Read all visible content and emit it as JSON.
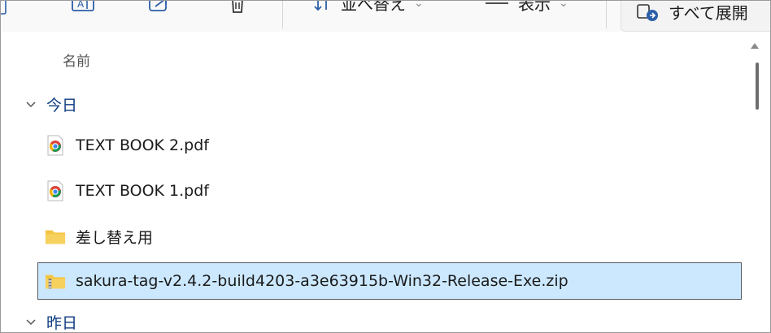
{
  "toolbar": {
    "sort_label": "並べ替え",
    "view_label": "表示",
    "expand_label": "すべて展開"
  },
  "columns": {
    "name_header": "名前"
  },
  "groups": [
    {
      "label": "今日"
    },
    {
      "label": "昨日"
    }
  ],
  "files": [
    {
      "name": "TEXT BOOK 2.pdf",
      "icon": "chrome-pdf-icon"
    },
    {
      "name": "TEXT BOOK 1.pdf",
      "icon": "chrome-pdf-icon"
    },
    {
      "name": "差し替え用",
      "icon": "folder-icon"
    },
    {
      "name": "sakura-tag-v2.4.2-build4203-a3e63915b-Win32-Release-Exe.zip",
      "icon": "zip-folder-icon",
      "selected": true
    }
  ],
  "colors": {
    "group_text": "#0b3a80",
    "selection_bg": "#cce8ff",
    "folder": "#f4c542"
  }
}
